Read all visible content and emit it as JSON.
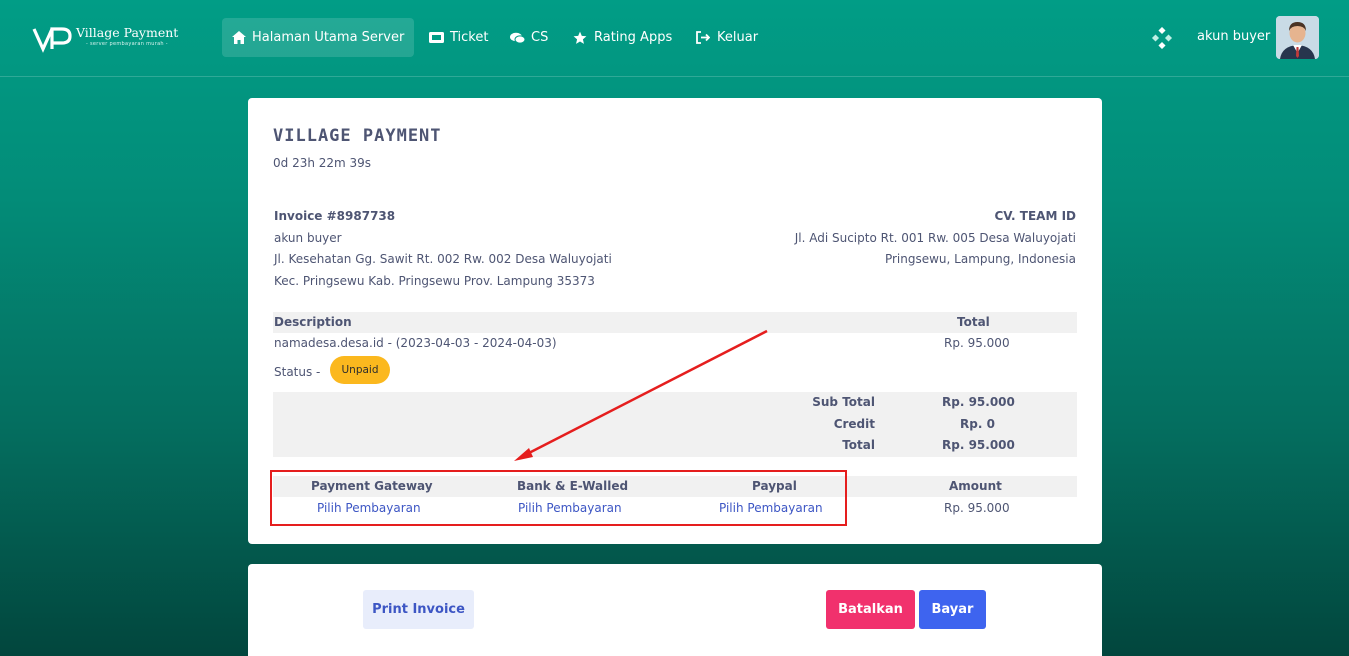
{
  "brand": {
    "name": "Village Payment",
    "tagline": "- server pembayaran murah -",
    "monogram": "VP"
  },
  "nav": {
    "items": [
      {
        "label": "Halaman Utama Server",
        "icon": "home-icon",
        "active": true
      },
      {
        "label": "Ticket",
        "icon": "ticket-icon",
        "active": false
      },
      {
        "label": "CS",
        "icon": "chat-icon",
        "active": false
      },
      {
        "label": "Rating Apps",
        "icon": "star-icon",
        "active": false
      },
      {
        "label": "Keluar",
        "icon": "logout-icon",
        "active": false
      }
    ],
    "apps_icon": "apps-grid-icon",
    "user": "akun buyer"
  },
  "invoice": {
    "title": "VILLAGE PAYMENT",
    "countdown": "0d 23h 22m 39s",
    "number": "Invoice #8987738",
    "buyer": {
      "name": "akun buyer",
      "address1": "Jl. Kesehatan Gg. Sawit Rt. 002 Rw. 002 Desa Waluyojati",
      "address2": "Kec. Pringsewu Kab. Pringsewu Prov. Lampung 35373"
    },
    "seller": {
      "name": "CV. TEAM ID",
      "address1": "Jl. Adi Sucipto Rt. 001 Rw. 005 Desa Waluyojati",
      "address2": "Pringsewu, Lampung, Indonesia"
    },
    "table": {
      "description_header": "Description",
      "total_header": "Total",
      "item_description": "namadesa.desa.id - (2023-04-03 - 2024-04-03)",
      "item_total": "Rp. 95.000",
      "status_label": "Status -",
      "status_value": "Unpaid"
    },
    "summary": {
      "subtotal_label": "Sub Total",
      "subtotal_value": "Rp. 95.000",
      "credit_label": "Credit",
      "credit_value": "Rp. 0",
      "total_label": "Total",
      "total_value": "Rp. 95.000"
    },
    "payment": {
      "gateway_header": "Payment Gateway",
      "bank_header": "Bank & E-Walled",
      "paypal_header": "Paypal",
      "amount_header": "Amount",
      "gateway_link": "Pilih Pembayaran",
      "bank_link": "Pilih Pembayaran",
      "paypal_link": "Pilih Pembayaran",
      "amount_value": "Rp. 95.000"
    }
  },
  "actions": {
    "print": "Print Invoice",
    "cancel": "Batalkan",
    "pay": "Bayar"
  },
  "colors": {
    "accent": "#019d86",
    "highlight": "#e51e1e",
    "badge": "#fbb81e",
    "cancel": "#f1316d",
    "pay": "#3e64ef"
  }
}
